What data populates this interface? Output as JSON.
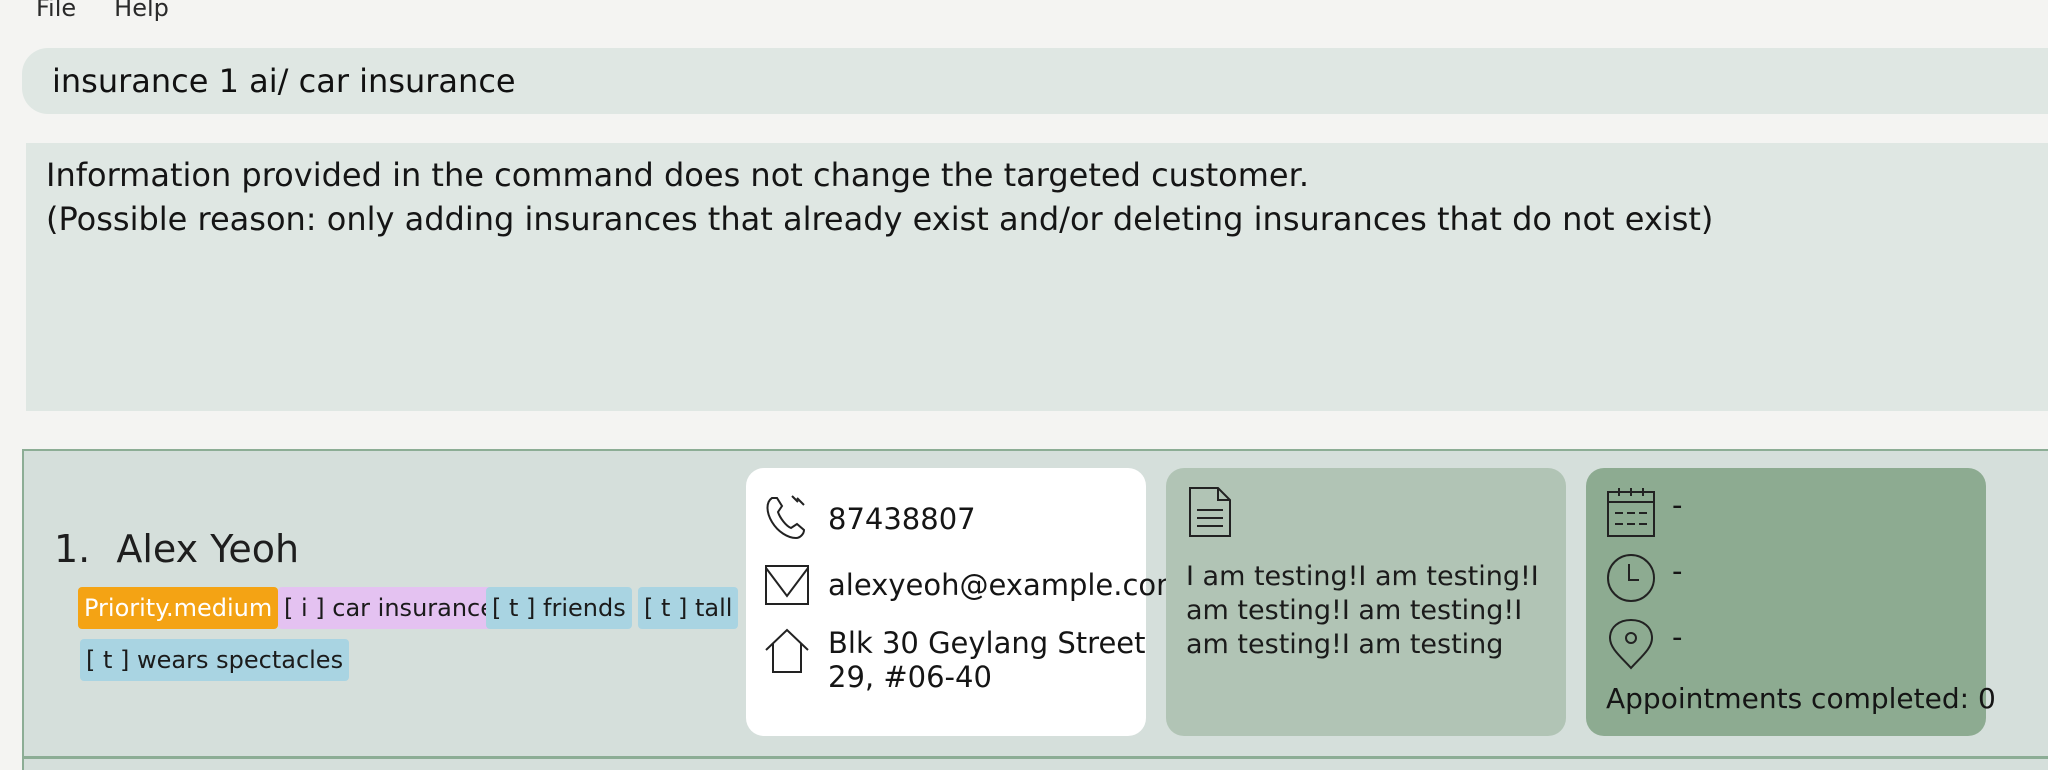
{
  "menu": {
    "file": "File",
    "help": "Help"
  },
  "command_input": {
    "value": "insurance 1 ai/ car insurance"
  },
  "result": {
    "line1": "Information provided in the command does not change the targeted customer.",
    "line2": "(Possible reason: only adding insurances that already exist and/or deleting insurances that do not exist)"
  },
  "customers": [
    {
      "index": "1.",
      "name": "Alex Yeoh",
      "tags": {
        "priority": "Priority.medium",
        "insurance": "[ i ] car insurance",
        "t1": "[ t ] friends",
        "t2": "[ t ] tall",
        "t3": "[ t ] wears spectacles"
      },
      "phone": "87438807",
      "email": "alexyeoh@example.com",
      "address_line1": "Blk 30 Geylang Street",
      "address_line2": "29, #06-40",
      "remark": "I am testing!I am testing!I am testing!I am testing!I am testing!I am testing",
      "appointment": {
        "date": "-",
        "time": "-",
        "venue": "-"
      },
      "appointments_completed": "Appointments completed: 0"
    }
  ],
  "colors": {
    "priority_tag": "#f4a314",
    "insurance_tag": "#e4c2f1",
    "plain_tag": "#a9d4e2",
    "remark_card": "#b1c4b5",
    "appointment_card": "#8dab91"
  },
  "icons": [
    "phone-icon",
    "email-icon",
    "home-icon",
    "document-icon",
    "calendar-icon",
    "clock-icon",
    "location-pin-icon"
  ]
}
